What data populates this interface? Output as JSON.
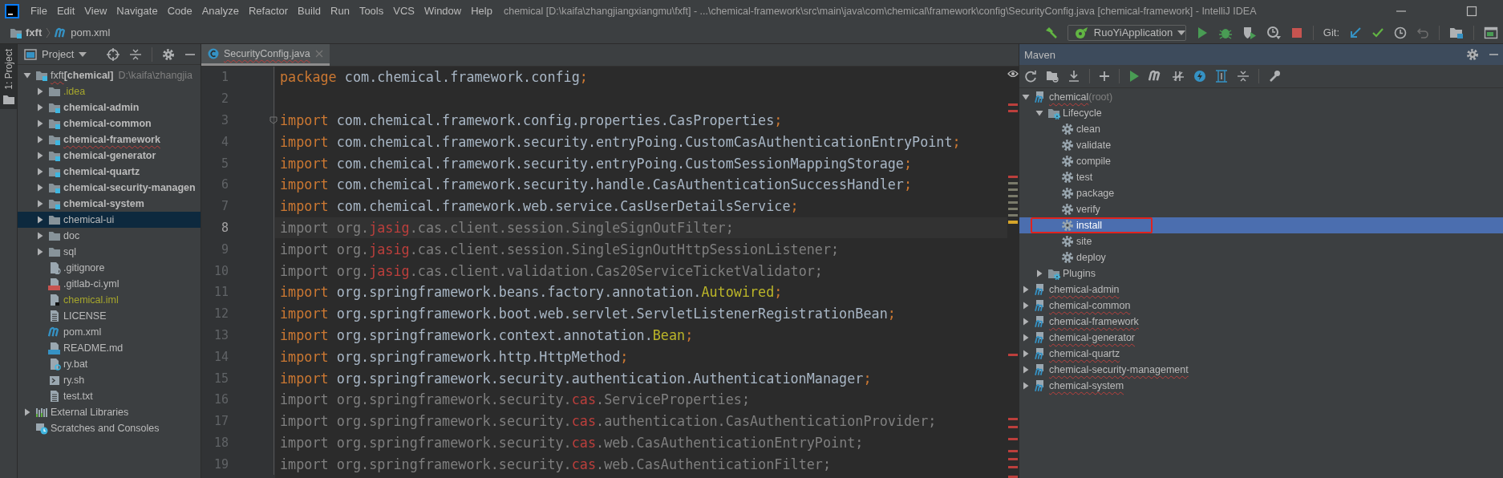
{
  "menu_bar": {
    "items": [
      "File",
      "Edit",
      "View",
      "Navigate",
      "Code",
      "Analyze",
      "Refactor",
      "Build",
      "Run",
      "Tools",
      "VCS",
      "Window",
      "Help"
    ],
    "title": "chemical [D:\\kaifa\\zhangjiangxiangmu\\fxft] - ...\\chemical-framework\\src\\main\\java\\com\\chemical\\framework\\config\\SecurityConfig.java [chemical-framework] - IntelliJ IDEA"
  },
  "navigation_bar": {
    "breadcrumbs": [
      {
        "label": "fxft",
        "kind": "module"
      },
      {
        "label": "pom.xml",
        "kind": "maven"
      }
    ],
    "run_configuration": "RuoYiApplication",
    "vcs_label": "Git:"
  },
  "tool_stripe": {
    "tabs": [
      {
        "label": "1: Project",
        "selected": true
      }
    ]
  },
  "project_panel": {
    "title": "Project",
    "tree": [
      {
        "label": "fxft",
        "tag": "[chemical]",
        "path": "D:\\kaifa\\zhangjia",
        "kind": "module",
        "expanded": true,
        "selected": false,
        "typo": true,
        "children": [
          {
            "label": ".idea",
            "kind": "folder",
            "expanded": false,
            "selected": false,
            "ignored": true
          },
          {
            "label": "chemical-admin",
            "kind": "module",
            "expanded": false,
            "selected": false
          },
          {
            "label": "chemical-common",
            "kind": "module",
            "expanded": false,
            "selected": false
          },
          {
            "label": "chemical-framework",
            "kind": "module",
            "expanded": false,
            "selected": false,
            "typo": true
          },
          {
            "label": "chemical-generator",
            "kind": "module",
            "expanded": false,
            "selected": false
          },
          {
            "label": "chemical-quartz",
            "kind": "module",
            "expanded": false,
            "selected": false
          },
          {
            "label": "chemical-security-managen",
            "kind": "module",
            "expanded": false,
            "selected": false
          },
          {
            "label": "chemical-system",
            "kind": "module",
            "expanded": false,
            "selected": false
          },
          {
            "label": "chemical-ui",
            "kind": "folder",
            "expanded": false,
            "selected": true
          },
          {
            "label": "doc",
            "kind": "folder",
            "expanded": false,
            "selected": false
          },
          {
            "label": "sql",
            "kind": "folder",
            "expanded": false,
            "selected": false
          },
          {
            "label": ".gitignore",
            "kind": "ignore",
            "selected": false
          },
          {
            "label": ".gitlab-ci.yml",
            "kind": "yml",
            "selected": false
          },
          {
            "label": "chemical.iml",
            "kind": "iml",
            "selected": false,
            "ignored": true
          },
          {
            "label": "LICENSE",
            "kind": "text",
            "selected": false
          },
          {
            "label": "pom.xml",
            "kind": "maven",
            "selected": false
          },
          {
            "label": "README.md",
            "kind": "md",
            "selected": false
          },
          {
            "label": "ry.bat",
            "kind": "unknown",
            "selected": false
          },
          {
            "label": "ry.sh",
            "kind": "shell",
            "selected": false
          },
          {
            "label": "test.txt",
            "kind": "text",
            "selected": false
          }
        ]
      },
      {
        "label": "External Libraries",
        "kind": "library",
        "expanded": false,
        "selected": false
      },
      {
        "label": "Scratches and Consoles",
        "kind": "scratches",
        "selected": false
      }
    ]
  },
  "editor": {
    "tabs": [
      {
        "label": "SecurityConfig.java",
        "selected": true,
        "typo": true
      }
    ],
    "lines": [
      {
        "number": "1",
        "current": false,
        "unused": false,
        "segments": [
          {
            "text": "package",
            "kind": "keyword"
          },
          {
            "text": " com.chemical.framework.config",
            "kind": "plain"
          },
          {
            "text": ";",
            "kind": "punct"
          }
        ]
      },
      {
        "number": "2",
        "current": false
      },
      {
        "number": "3",
        "current": false,
        "unused": false,
        "fold": true,
        "segments": [
          {
            "text": "import",
            "kind": "keyword"
          },
          {
            "text": " com.chemical.framework.config.properties.CasProperties",
            "kind": "plain"
          },
          {
            "text": ";",
            "kind": "punct"
          }
        ]
      },
      {
        "number": "4",
        "current": false,
        "unused": false,
        "segments": [
          {
            "text": "import",
            "kind": "keyword"
          },
          {
            "text": " com.chemical.framework.security.entryPoing.CustomCasAuthenticationEntryPoint",
            "kind": "plain"
          },
          {
            "text": ";",
            "kind": "punct"
          }
        ]
      },
      {
        "number": "5",
        "current": false,
        "unused": false,
        "segments": [
          {
            "text": "import",
            "kind": "keyword"
          },
          {
            "text": " com.chemical.framework.security.entryPoing.CustomSessionMappingStorage",
            "kind": "plain"
          },
          {
            "text": ";",
            "kind": "punct"
          }
        ]
      },
      {
        "number": "6",
        "current": false,
        "unused": false,
        "segments": [
          {
            "text": "import",
            "kind": "keyword"
          },
          {
            "text": " com.chemical.framework.security.handle.CasAuthenticationSuccessHandler",
            "kind": "plain"
          },
          {
            "text": ";",
            "kind": "punct"
          }
        ]
      },
      {
        "number": "7",
        "current": false,
        "unused": false,
        "segments": [
          {
            "text": "import",
            "kind": "keyword"
          },
          {
            "text": " com.chemical.framework.web.service.CasUserDetailsService",
            "kind": "plain"
          },
          {
            "text": ";",
            "kind": "punct"
          }
        ]
      },
      {
        "number": "8",
        "current": true,
        "unused": true,
        "segments": [
          {
            "text": "import",
            "kind": "keyword"
          },
          {
            "text": " org.",
            "kind": "plain"
          },
          {
            "text": "jasig",
            "kind": "unresolved"
          },
          {
            "text": ".cas.client.session.SingleSignOutFilter",
            "kind": "plain"
          },
          {
            "text": ";",
            "kind": "punct"
          }
        ]
      },
      {
        "number": "9",
        "current": false,
        "unused": true,
        "segments": [
          {
            "text": "import",
            "kind": "keyword"
          },
          {
            "text": " org.",
            "kind": "plain"
          },
          {
            "text": "jasig",
            "kind": "unresolved"
          },
          {
            "text": ".cas.client.session.SingleSignOutHttpSessionListener",
            "kind": "plain"
          },
          {
            "text": ";",
            "kind": "punct"
          }
        ]
      },
      {
        "number": "10",
        "current": false,
        "unused": true,
        "segments": [
          {
            "text": "import",
            "kind": "keyword"
          },
          {
            "text": " org.",
            "kind": "plain"
          },
          {
            "text": "jasig",
            "kind": "unresolved"
          },
          {
            "text": ".cas.client.validation.Cas20ServiceTicketValidator",
            "kind": "plain"
          },
          {
            "text": ";",
            "kind": "punct"
          }
        ]
      },
      {
        "number": "11",
        "current": false,
        "unused": false,
        "segments": [
          {
            "text": "import",
            "kind": "keyword"
          },
          {
            "text": " org.springframework.beans.factory.annotation.",
            "kind": "plain"
          },
          {
            "text": "Autowired",
            "kind": "annotation"
          },
          {
            "text": ";",
            "kind": "punct"
          }
        ]
      },
      {
        "number": "12",
        "current": false,
        "unused": false,
        "segments": [
          {
            "text": "import",
            "kind": "keyword"
          },
          {
            "text": " org.springframework.boot.web.servlet.ServletListenerRegistrationBean",
            "kind": "plain"
          },
          {
            "text": ";",
            "kind": "punct"
          }
        ]
      },
      {
        "number": "13",
        "current": false,
        "unused": false,
        "segments": [
          {
            "text": "import",
            "kind": "keyword"
          },
          {
            "text": " org.springframework.context.annotation.",
            "kind": "plain"
          },
          {
            "text": "Bean",
            "kind": "annotation"
          },
          {
            "text": ";",
            "kind": "punct"
          }
        ]
      },
      {
        "number": "14",
        "current": false,
        "unused": false,
        "segments": [
          {
            "text": "import",
            "kind": "keyword"
          },
          {
            "text": " org.springframework.http.HttpMethod",
            "kind": "plain"
          },
          {
            "text": ";",
            "kind": "punct"
          }
        ]
      },
      {
        "number": "15",
        "current": false,
        "unused": false,
        "segments": [
          {
            "text": "import",
            "kind": "keyword"
          },
          {
            "text": " org.springframework.security.authentication.AuthenticationManager",
            "kind": "plain"
          },
          {
            "text": ";",
            "kind": "punct"
          }
        ]
      },
      {
        "number": "16",
        "current": false,
        "unused": true,
        "segments": [
          {
            "text": "import",
            "kind": "keyword"
          },
          {
            "text": " org.springframework.security.",
            "kind": "plain"
          },
          {
            "text": "cas",
            "kind": "unresolved"
          },
          {
            "text": ".ServiceProperties",
            "kind": "plain"
          },
          {
            "text": ";",
            "kind": "punct"
          }
        ]
      },
      {
        "number": "17",
        "current": false,
        "unused": true,
        "segments": [
          {
            "text": "import",
            "kind": "keyword"
          },
          {
            "text": " org.springframework.security.",
            "kind": "plain"
          },
          {
            "text": "cas",
            "kind": "unresolved"
          },
          {
            "text": ".authentication.CasAuthenticationProvider",
            "kind": "plain"
          },
          {
            "text": ";",
            "kind": "punct"
          }
        ]
      },
      {
        "number": "18",
        "current": false,
        "unused": true,
        "segments": [
          {
            "text": "import",
            "kind": "keyword"
          },
          {
            "text": " org.springframework.security.",
            "kind": "plain"
          },
          {
            "text": "cas",
            "kind": "unresolved"
          },
          {
            "text": ".web.CasAuthenticationEntryPoint",
            "kind": "plain"
          },
          {
            "text": ";",
            "kind": "punct"
          }
        ]
      },
      {
        "number": "19",
        "current": false,
        "unused": true,
        "segments": [
          {
            "text": "import",
            "kind": "keyword"
          },
          {
            "text": " org.springframework.security.",
            "kind": "plain"
          },
          {
            "text": "cas",
            "kind": "unresolved"
          },
          {
            "text": ".web.CasAuthenticationFilter",
            "kind": "plain"
          },
          {
            "text": ";",
            "kind": "punct"
          }
        ]
      }
    ]
  },
  "maven_panel": {
    "title": "Maven",
    "tree": [
      {
        "label": "chemical",
        "note": "(root)",
        "kind": "module",
        "expanded": true,
        "selected": false,
        "typo": true,
        "children": [
          {
            "label": "Lifecycle",
            "kind": "lifecycle",
            "expanded": true,
            "selected": false,
            "children": [
              {
                "label": "clean",
                "kind": "goal",
                "selected": false
              },
              {
                "label": "validate",
                "kind": "goal",
                "selected": false
              },
              {
                "label": "compile",
                "kind": "goal",
                "selected": false
              },
              {
                "label": "test",
                "kind": "goal",
                "selected": false
              },
              {
                "label": "package",
                "kind": "goal",
                "selected": false
              },
              {
                "label": "verify",
                "kind": "goal",
                "selected": false
              },
              {
                "label": "install",
                "kind": "goal",
                "selected": true,
                "highlighted": true
              },
              {
                "label": "site",
                "kind": "goal",
                "selected": false
              },
              {
                "label": "deploy",
                "kind": "goal",
                "selected": false
              }
            ]
          },
          {
            "label": "Plugins",
            "kind": "lifecycle",
            "expanded": false,
            "selected": false
          }
        ]
      },
      {
        "label": "chemical-admin",
        "kind": "module",
        "expanded": false,
        "selected": false,
        "typo": true
      },
      {
        "label": "chemical-common",
        "kind": "module",
        "expanded": false,
        "selected": false,
        "typo": true
      },
      {
        "label": "chemical-framework",
        "kind": "module",
        "expanded": false,
        "selected": false,
        "typo": true
      },
      {
        "label": "chemical-generator",
        "kind": "module",
        "expanded": false,
        "selected": false,
        "typo": true
      },
      {
        "label": "chemical-quartz",
        "kind": "module",
        "expanded": false,
        "selected": false,
        "typo": true
      },
      {
        "label": "chemical-security-management",
        "kind": "module",
        "expanded": false,
        "selected": false,
        "typo": true
      },
      {
        "label": "chemical-system",
        "kind": "module",
        "expanded": false,
        "selected": false,
        "typo": true
      }
    ]
  }
}
